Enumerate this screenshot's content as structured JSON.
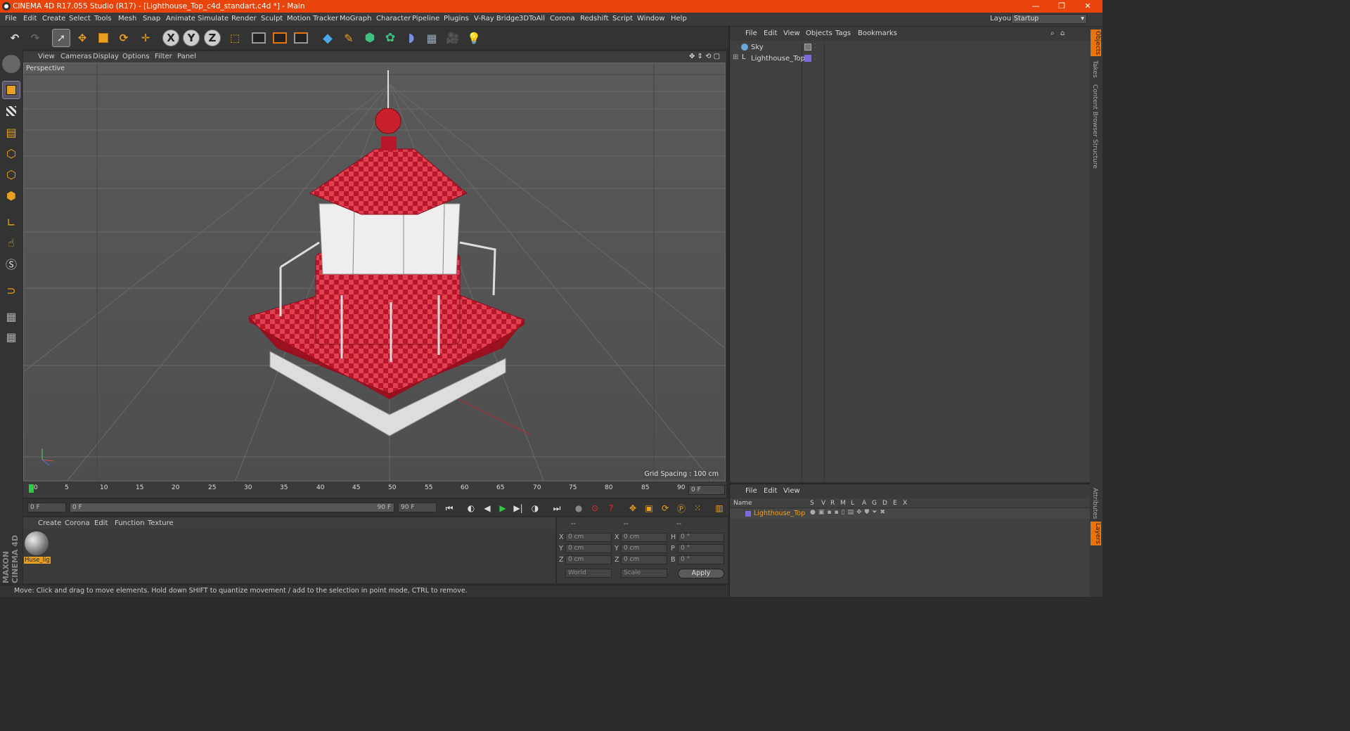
{
  "window": {
    "title": "CINEMA 4D R17.055 Studio (R17) - [Lighthouse_Top_c4d_standart.c4d *] - Main",
    "minimize": "—",
    "restore": "❐",
    "close": "✕"
  },
  "menubar": {
    "items": [
      "File",
      "Edit",
      "Create",
      "Select",
      "Tools",
      "Mesh",
      "Snap",
      "Animate",
      "Simulate",
      "Render",
      "Sculpt",
      "Motion Tracker",
      "MoGraph",
      "Character",
      "Pipeline",
      "Plugins",
      "V-Ray Bridge",
      "3DToAll",
      "Corona",
      "Redshift",
      "Script",
      "Window",
      "Help"
    ],
    "layout_label": "Layout:",
    "layout_value": "Startup"
  },
  "toolbar": {
    "icons": [
      "undo-icon",
      "redo-icon",
      "select-arrow-icon",
      "move-icon",
      "scale-icon",
      "rotate-icon",
      "live-selection-icon",
      "x-axis-icon",
      "y-axis-icon",
      "z-axis-icon",
      "world-coord-icon",
      "render-view-icon",
      "render-picture-viewer-icon",
      "edit-render-settings-icon",
      "cube-icon",
      "pen-icon",
      "subdivision-icon",
      "cloner-icon",
      "deformer-icon",
      "floor-icon",
      "camera-icon",
      "light-icon"
    ],
    "x": "X",
    "y": "Y",
    "z": "Z"
  },
  "viewport": {
    "menu": [
      "View",
      "Cameras",
      "Display",
      "Options",
      "Filter",
      "Panel"
    ],
    "label": "Perspective",
    "grid_spacing": "Grid Spacing : 100 cm"
  },
  "timeline": {
    "ticks": [
      "0",
      "5",
      "10",
      "15",
      "20",
      "25",
      "30",
      "35",
      "40",
      "45",
      "50",
      "55",
      "60",
      "65",
      "70",
      "75",
      "80",
      "85",
      "90"
    ],
    "current_frame": "0 F"
  },
  "transport": {
    "start": "0 F",
    "slider_start": "0 F",
    "slider_end": "90 F",
    "end": "90 F"
  },
  "material_panel": {
    "menu": [
      "Create",
      "Corona",
      "Edit",
      "Function",
      "Texture"
    ],
    "material_name": "Huse_lig"
  },
  "coords": {
    "headers": [
      "--",
      "--",
      "--"
    ],
    "rows": [
      {
        "a": "X",
        "v1": "0 cm",
        "b": "X",
        "v2": "0 cm",
        "c": "H",
        "v3": "0 °"
      },
      {
        "a": "Y",
        "v1": "0 cm",
        "b": "Y",
        "v2": "0 cm",
        "c": "P",
        "v3": "0 °"
      },
      {
        "a": "Z",
        "v1": "0 cm",
        "b": "Z",
        "v2": "0 cm",
        "c": "B",
        "v3": "0 °"
      }
    ],
    "world": "World",
    "scale": "Scale",
    "apply": "Apply"
  },
  "status": {
    "text": "Move: Click and drag to move elements. Hold down SHIFT to quantize movement / add to the selection in point mode, CTRL to remove."
  },
  "object_manager": {
    "menu": [
      "File",
      "Edit",
      "View",
      "Objects",
      "Tags",
      "Bookmarks"
    ],
    "objects": [
      "Sky",
      "Lighthouse_Top"
    ]
  },
  "layer_manager": {
    "menu": [
      "File",
      "Edit",
      "View"
    ],
    "columns": [
      "Name",
      "S",
      "V",
      "R",
      "M",
      "L",
      "A",
      "G",
      "D",
      "E",
      "X"
    ],
    "layer": "Lighthouse_Top"
  },
  "side_tabs": [
    "Objects",
    "Takes",
    "Content Browser",
    "Structure"
  ],
  "side_tabs_bottom": [
    "Attributes",
    "Layers"
  ],
  "branding": "MAXON CINEMA 4D",
  "colors": {
    "title_bar": "#e8440c",
    "accent_orange": "#e8740c",
    "layer_name": "#f0a020",
    "lighthouse_red": "#c8202c"
  }
}
